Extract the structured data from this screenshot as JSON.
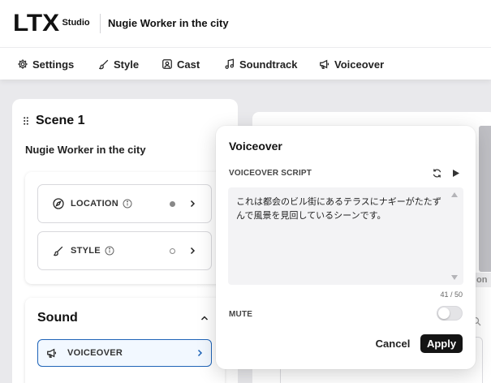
{
  "header": {
    "logo_text": "LTX",
    "logo_sub": "Studio",
    "project_title": "Nugie Worker in the city"
  },
  "tabs": [
    {
      "label": "Settings",
      "icon": "gear-icon"
    },
    {
      "label": "Style",
      "icon": "brush-icon"
    },
    {
      "label": "Cast",
      "icon": "person-icon"
    },
    {
      "label": "Soundtrack",
      "icon": "music-note-icon"
    },
    {
      "label": "Voiceover",
      "icon": "megaphone-icon"
    }
  ],
  "scene": {
    "title": "Scene 1",
    "subtitle": "Nugie Worker in the city",
    "items": [
      {
        "label": "LOCATION",
        "icon": "compass-icon",
        "status": "filled"
      },
      {
        "label": "STYLE",
        "icon": "brush-icon",
        "status": "empty"
      }
    ]
  },
  "sound": {
    "title": "Sound",
    "items": [
      {
        "label": "VOICEOVER",
        "icon": "megaphone-icon",
        "selected": true
      }
    ]
  },
  "right_panel": {
    "strip_text": "on"
  },
  "voiceover_popover": {
    "title": "Voiceover",
    "script_label": "VOICEOVER SCRIPT",
    "script_text": "これは都会のビル街にあるテラスにナギーがたたずんで風景を見回しているシーンです。",
    "counter": "41 / 50",
    "mute_label": "MUTE",
    "mute_on": false,
    "cancel_label": "Cancel",
    "apply_label": "Apply"
  },
  "colors": {
    "accent": "#1f64b8",
    "apply_bg": "#141414",
    "location_dot": "#888888"
  }
}
